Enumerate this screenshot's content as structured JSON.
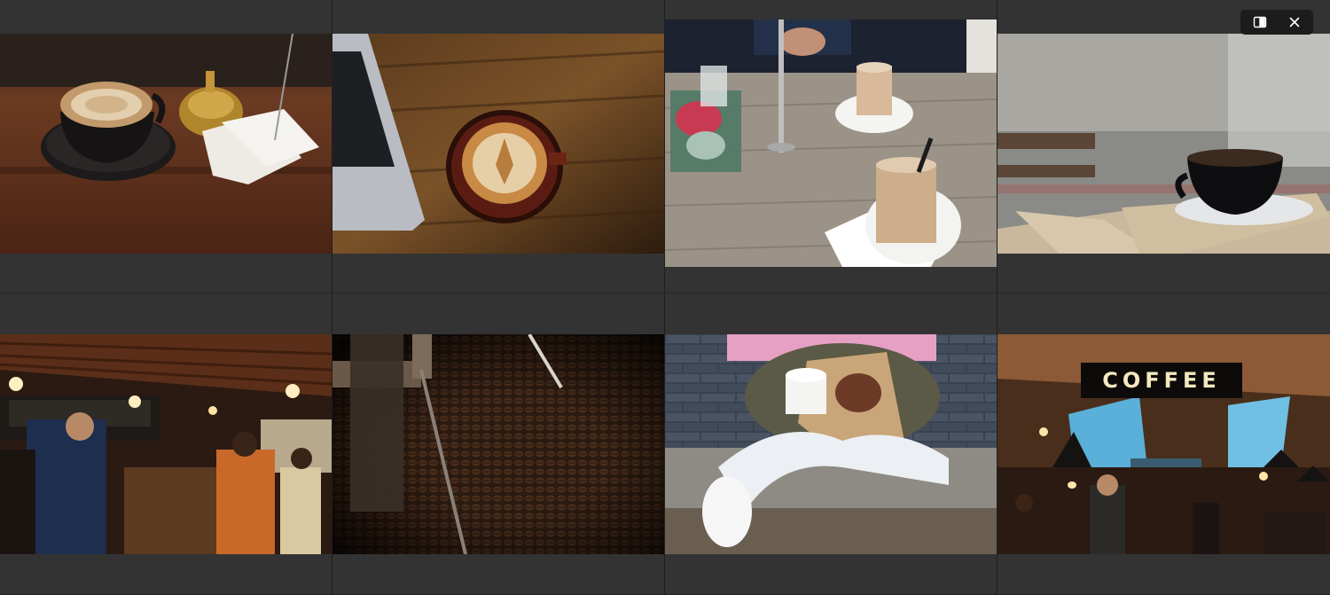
{
  "gallery": {
    "photos": [
      {
        "subject": "latte-art-cup-on-wooden-bar"
      },
      {
        "subject": "latte-beside-laptop-on-wood-table"
      },
      {
        "subject": "iced-coffees-on-rustic-table"
      },
      {
        "subject": "black-coffee-cup-on-outdoor-table"
      },
      {
        "subject": "busy-coffee-shop-counter"
      },
      {
        "subject": "coffee-beans-roaster"
      },
      {
        "subject": "person-with-coffee-cup-and-pastry"
      },
      {
        "subject": "coffee-shop-interior"
      }
    ],
    "coffee_sign_text": "COFFEE"
  },
  "toolbar": {
    "split_view_icon": "split-view-icon",
    "close_icon": "close-icon"
  },
  "colors": {
    "background": "#2f2f2f",
    "cell": "#333333",
    "toolbar": "#1c1c1c",
    "icon": "#ffffff"
  }
}
